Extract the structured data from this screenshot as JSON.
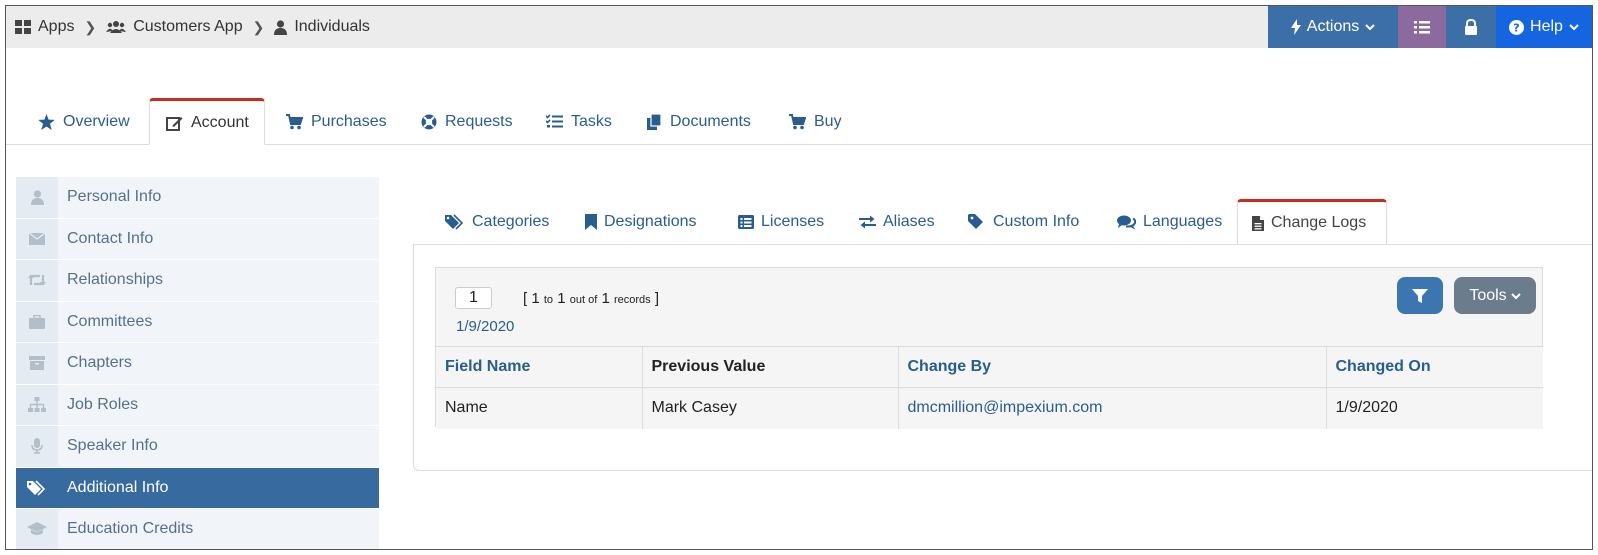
{
  "breadcrumbs": {
    "apps": "Apps",
    "customers_app": "Customers App",
    "individuals": "Individuals"
  },
  "top_buttons": {
    "actions": "Actions",
    "help": "Help"
  },
  "main_tabs": [
    {
      "label": "Overview"
    },
    {
      "label": "Account"
    },
    {
      "label": "Purchases"
    },
    {
      "label": "Requests"
    },
    {
      "label": "Tasks"
    },
    {
      "label": "Documents"
    },
    {
      "label": "Buy"
    }
  ],
  "sidebar": {
    "items": [
      {
        "label": "Personal Info"
      },
      {
        "label": "Contact Info"
      },
      {
        "label": "Relationships"
      },
      {
        "label": "Committees"
      },
      {
        "label": "Chapters"
      },
      {
        "label": "Job Roles"
      },
      {
        "label": "Speaker Info"
      },
      {
        "label": "Additional Info"
      },
      {
        "label": "Education Credits"
      }
    ]
  },
  "sub_tabs": [
    {
      "label": "Categories"
    },
    {
      "label": "Designations"
    },
    {
      "label": "Licenses"
    },
    {
      "label": "Aliases"
    },
    {
      "label": "Custom Info"
    },
    {
      "label": "Languages"
    },
    {
      "label": "Change Logs"
    }
  ],
  "grid": {
    "page_input": "1",
    "range_open": "[",
    "range_from": "1",
    "range_to_word": "to",
    "range_to": "1",
    "range_out_of": "out of",
    "range_total": "1",
    "range_records": "records",
    "range_close": "]",
    "date_link": "1/9/2020",
    "tools_label": "Tools",
    "columns": [
      "Field Name",
      "Previous Value",
      "Change By",
      "Changed On"
    ],
    "rows": [
      [
        "Name",
        "Mark Casey",
        "dmcmillion@impexium.com",
        "1/9/2020"
      ]
    ]
  },
  "colors": {
    "active_tab_border": "#cc2a1d",
    "sidebar_active": "#376a9e",
    "link": "#2a5d8f",
    "help_button": "#1565e0"
  }
}
